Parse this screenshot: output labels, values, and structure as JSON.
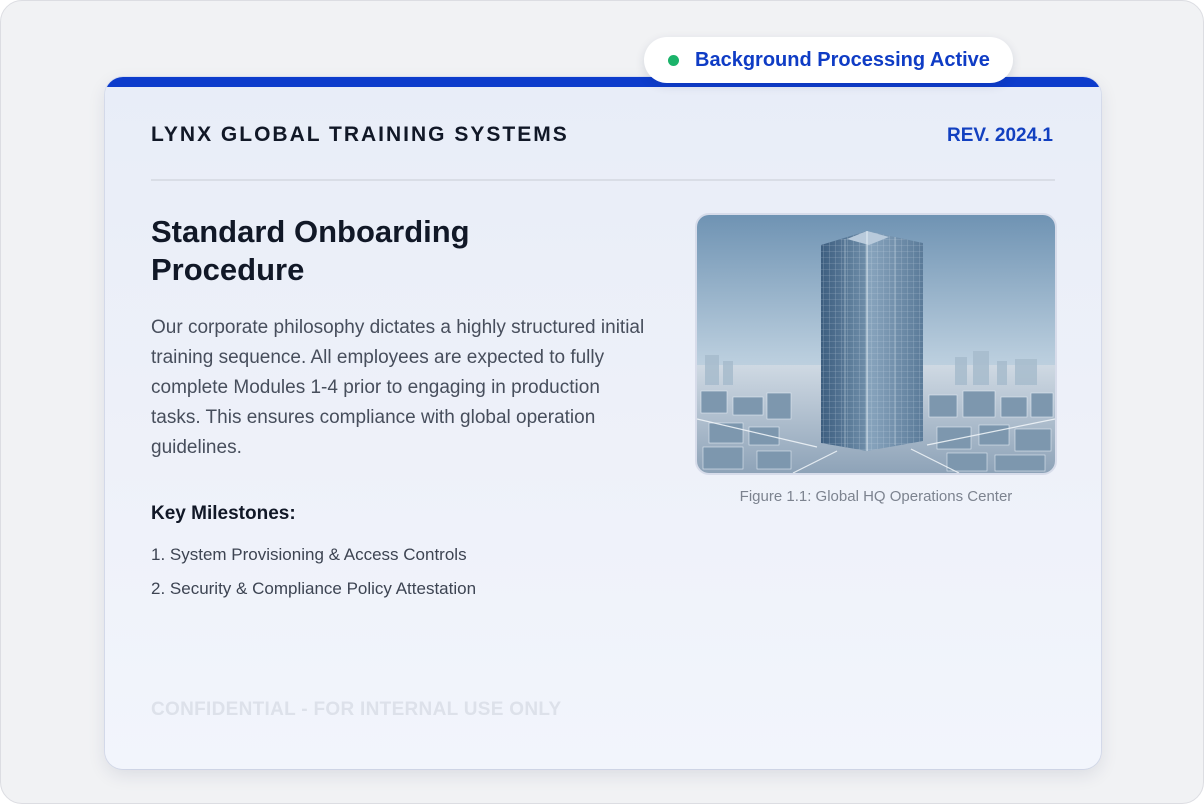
{
  "status_pill": {
    "label": "Background Processing Active",
    "dot_color": "#1bb36a",
    "icon": "status-dot-icon"
  },
  "header": {
    "organization": "LYNX GLOBAL TRAINING SYSTEMS",
    "revision": "REV. 2024.1",
    "accent_color": "#0d3ccc"
  },
  "content": {
    "title": "Standard Onboarding Procedure",
    "body": "Our corporate philosophy dictates a highly structured initial training sequence. All employees are expected to fully complete Modules 1-4 prior to engaging in production tasks. This ensures compliance with global operation guidelines.",
    "milestones": {
      "heading": "Key Milestones:",
      "items": [
        "1. System Provisioning & Access Controls",
        "2. Security & Compliance Policy Attestation"
      ]
    }
  },
  "figure": {
    "image_subject": "glass-skyscraper-cityscape",
    "caption": "Figure 1.1: Global HQ Operations Center"
  },
  "footer": {
    "watermark": "CONFIDENTIAL - FOR INTERNAL USE ONLY"
  }
}
